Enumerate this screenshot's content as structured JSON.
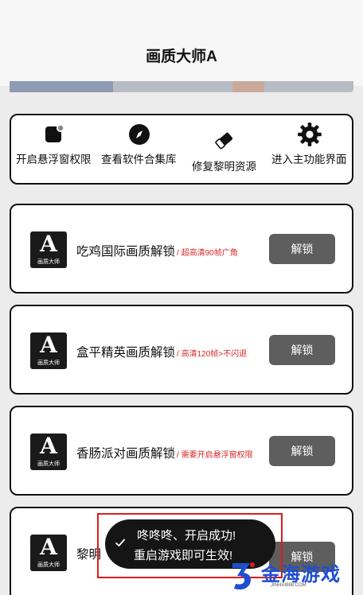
{
  "header": {
    "title": "画质大师A"
  },
  "quick_actions": [
    {
      "label": "开启悬浮窗权限",
      "icon": "app-badge-icon"
    },
    {
      "label": "查看软件合集库",
      "icon": "compass-icon"
    },
    {
      "label": "修复黎明资源",
      "icon": "eraser-icon"
    },
    {
      "label": "进入主功能界面",
      "icon": "gear-icon"
    }
  ],
  "cards": [
    {
      "title": "吃鸡国际画质解锁",
      "tag": "/ 超高清90帧广角",
      "button": "解锁",
      "logo_letter": "A",
      "logo_caption": "画质大师"
    },
    {
      "title": "盒平精英画质解锁",
      "tag": "/ 高清120帧>不闪退",
      "button": "解锁",
      "logo_letter": "A",
      "logo_caption": "画质大师"
    },
    {
      "title": "香肠派对画质解锁",
      "tag": "/ 需要开启悬浮窗权限",
      "button": "解锁",
      "logo_letter": "A",
      "logo_caption": "画质大师"
    },
    {
      "title": "黎明",
      "tag": "",
      "button": "解锁",
      "logo_letter": "A",
      "logo_caption": "画质大师"
    }
  ],
  "toast": {
    "line1": "咚咚咚、开启成功!",
    "line2": "重启游戏即可生效!"
  },
  "watermark": {
    "text": "金海游戏",
    "url": "JINHAI888.COM"
  },
  "colors": {
    "accent_red": "#d62828",
    "button_gray": "#5e5e5e",
    "highlight_box": "#e01b1b",
    "watermark_blue": "#1f4fd1"
  }
}
